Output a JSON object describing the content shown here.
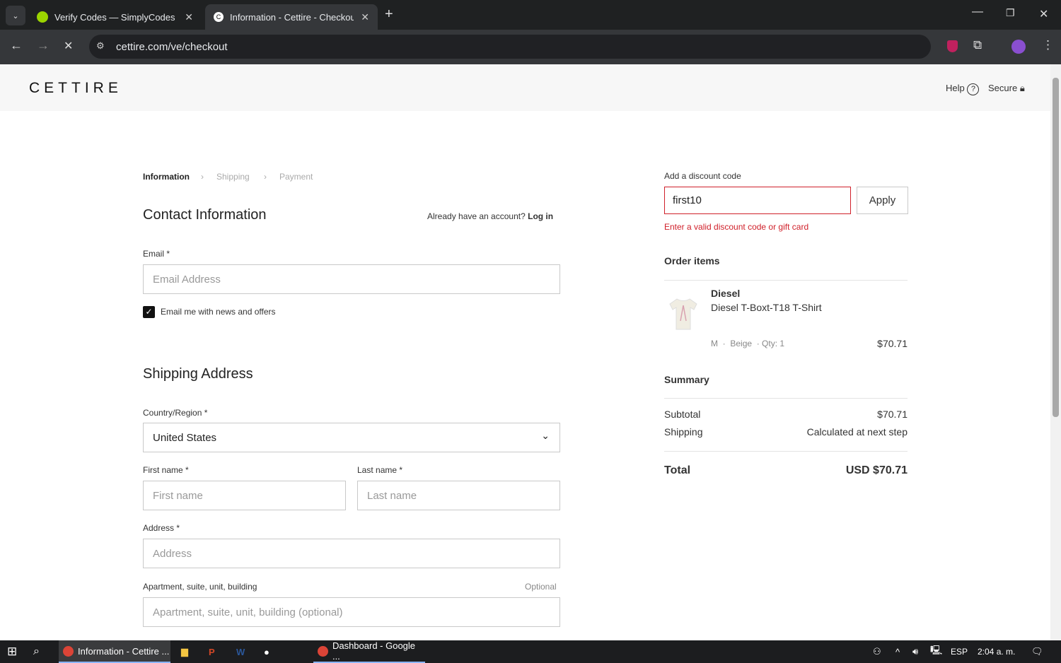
{
  "browser": {
    "tabs": [
      {
        "title": "Verify Codes — SimplyCodes",
        "active": false
      },
      {
        "title": "Information - Cettire - Checkou",
        "active": true
      }
    ],
    "url": "cettire.com/ve/checkout"
  },
  "header": {
    "logo": "CETTIRE",
    "help": "Help",
    "secure": "Secure"
  },
  "breadcrumb": [
    "Information",
    "Shipping",
    "Payment"
  ],
  "contact": {
    "title": "Contact Information",
    "account_prompt": "Already have an account?",
    "login": "Log in",
    "email_label": "Email *",
    "email_placeholder": "Email Address",
    "newsletter_label": "Email me with news and offers",
    "newsletter_checked": true
  },
  "shipping": {
    "title": "Shipping Address",
    "country_label": "Country/Region *",
    "country_value": "United States",
    "first_label": "First name *",
    "first_placeholder": "First name",
    "last_label": "Last name *",
    "last_placeholder": "Last name",
    "address_label": "Address *",
    "address_placeholder": "Address",
    "apt_label": "Apartment, suite, unit, building",
    "apt_optional": "Optional",
    "apt_placeholder": "Apartment, suite, unit, building (optional)"
  },
  "discount": {
    "label": "Add a discount code",
    "value": "first10",
    "apply": "Apply",
    "error": "Enter a valid discount code or gift card",
    "error_color": "#d0202a"
  },
  "order": {
    "title": "Order items",
    "items": [
      {
        "brand": "Diesel",
        "name": "Diesel T-Boxt-T18 T-Shirt",
        "size": "M",
        "color": "Beige",
        "qty": "Qty: 1",
        "price": "$70.71"
      }
    ]
  },
  "summary": {
    "title": "Summary",
    "subtotal_label": "Subtotal",
    "subtotal": "$70.71",
    "shipping_label": "Shipping",
    "shipping": "Calculated at next step",
    "total_label": "Total",
    "total": "USD $70.71"
  },
  "taskbar": {
    "apps": [
      "Information - Cettire ...",
      "Dashboard - Google ..."
    ],
    "lang": "ESP",
    "time": "2:04 a. m."
  }
}
